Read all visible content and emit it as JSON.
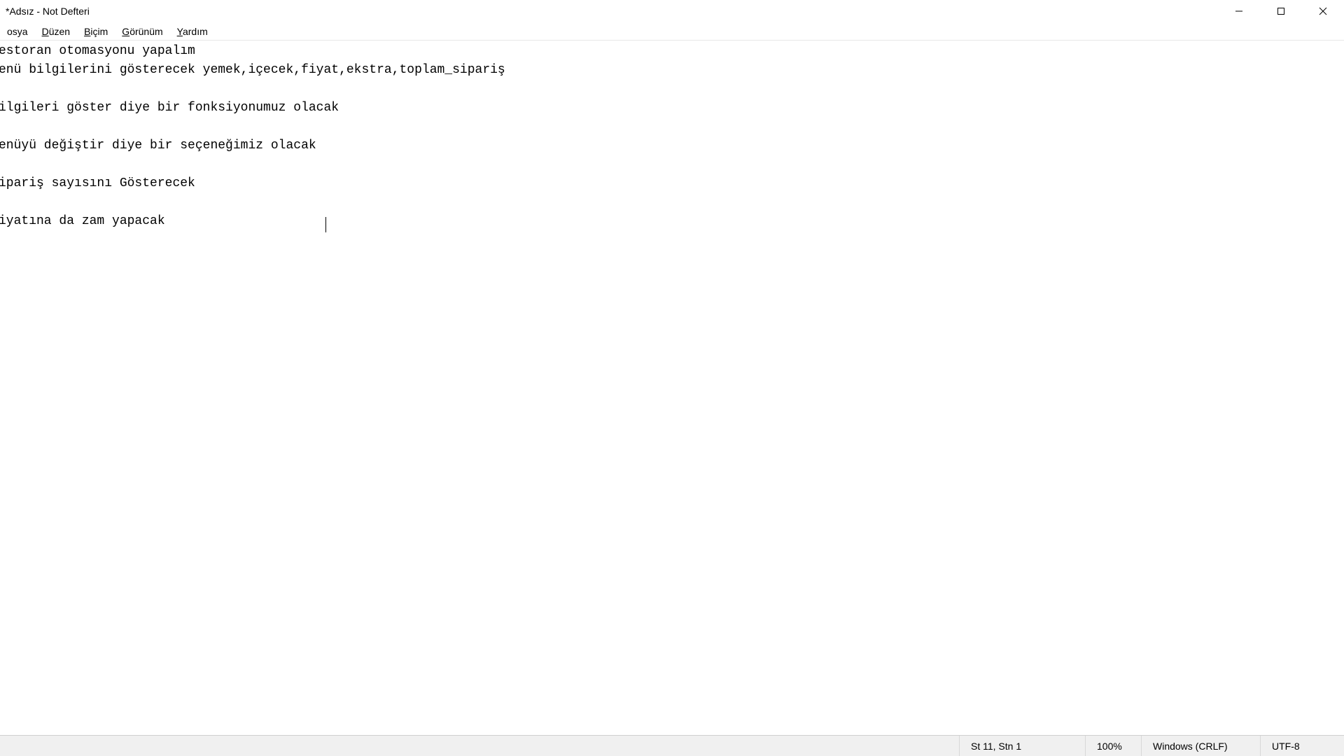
{
  "window": {
    "title": " *Adsız - Not Defteri"
  },
  "menu": {
    "file": "osya",
    "edit": "Düzen",
    "format": "Biçim",
    "view": "Görünüm",
    "help": "Yardım"
  },
  "content": "estoran otomasyonu yapalım\nenü bilgilerini gösterecek yemek,içecek,fiyat,ekstra,toplam_sipariş\n\nilgileri göster diye bir fonksiyonumuz olacak\n\nenüyü değiştir diye bir seçeneğimiz olacak\n\nipariş sayısını Gösterecek\n\niyatına da zam yapacak",
  "status": {
    "position": "St 11, Stn 1",
    "zoom": "100%",
    "line_ending": "Windows (CRLF)",
    "encoding": "UTF-8"
  }
}
